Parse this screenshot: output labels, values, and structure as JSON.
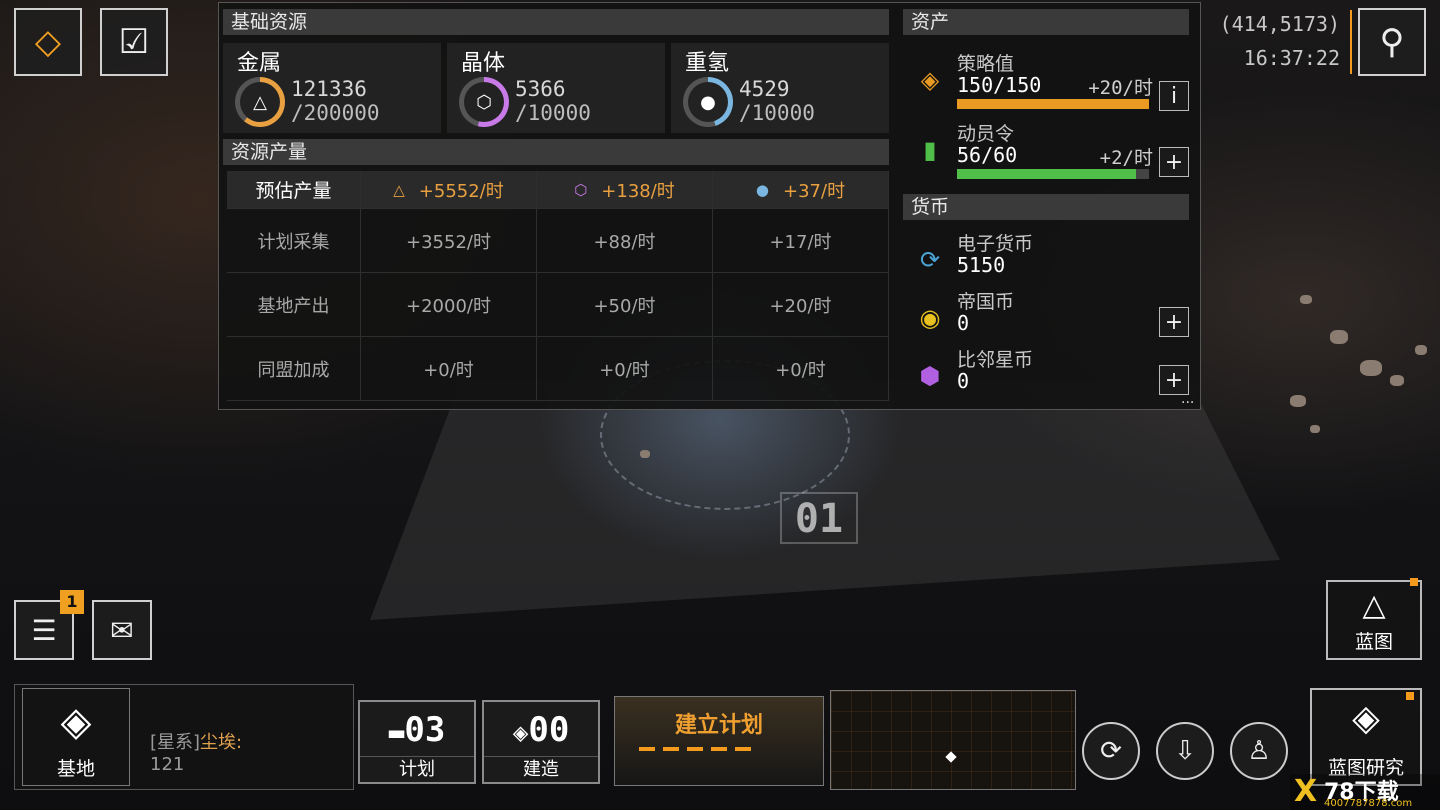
{
  "colors": {
    "accent": "#f49b1e",
    "metal": "#e8a040",
    "crystal": "#c87be8",
    "gas": "#7ab6e0",
    "strategy_bar": "#e89a22",
    "mobilize_bar": "#4fbf4a",
    "badge": "#f0a020"
  },
  "scene": {
    "plot_number": "01"
  },
  "top_left": {
    "buttons": [
      {
        "icon": "base-beacon-icon"
      },
      {
        "icon": "task-checklist-icon"
      }
    ]
  },
  "basic_resources": {
    "header": "基础资源",
    "items": [
      {
        "name": "金属",
        "current": "121336",
        "max": "/200000",
        "fill": 0.61,
        "icon": "metal-triangle-icon"
      },
      {
        "name": "晶体",
        "current": "5366",
        "max": "/10000",
        "fill": 0.54,
        "icon": "crystal-hexagon-icon"
      },
      {
        "name": "重氢",
        "current": "4529",
        "max": "/10000",
        "fill": 0.45,
        "icon": "deuterium-orb-icon"
      }
    ]
  },
  "production": {
    "header": "资源产量",
    "estimated_label": "预估产量",
    "estimated": [
      "+5552/时",
      "+138/时",
      "+37/时"
    ],
    "rows": [
      {
        "label": "计划采集",
        "values": [
          "+3552/时",
          "+88/时",
          "+17/时"
        ]
      },
      {
        "label": "基地产出",
        "values": [
          "+2000/时",
          "+50/时",
          "+20/时"
        ]
      },
      {
        "label": "同盟加成",
        "values": [
          "+0/时",
          "+0/时",
          "+0/时"
        ]
      }
    ]
  },
  "assets": {
    "header": "资产",
    "strategy": {
      "label": "策略值",
      "value": "150/150",
      "rate": "+20/时",
      "fill": 1.0,
      "button": "i"
    },
    "mobilize": {
      "label": "动员令",
      "value": "56/60",
      "rate": "+2/时",
      "fill": 0.93,
      "button": "+"
    }
  },
  "currency": {
    "header": "货币",
    "items": [
      {
        "label": "电子货币",
        "value": "5150",
        "icon": "e-currency-icon",
        "color": "#4ba3d6",
        "button": ""
      },
      {
        "label": "帝国币",
        "value": "0",
        "icon": "empire-coin-icon",
        "color": "#e8c020",
        "button": "+"
      },
      {
        "label": "比邻星币",
        "value": "0",
        "icon": "proxima-coin-icon",
        "color": "#b060e0",
        "button": "+"
      }
    ],
    "more": "..."
  },
  "status": {
    "coords": "(414,5173)",
    "clock": "16:37:22"
  },
  "left_side": {
    "notes_badge": "1"
  },
  "bottom": {
    "base_label": "基地",
    "system_label": "[星系]",
    "system_name": "尘埃:",
    "system_value": "121",
    "plans": {
      "count": "03",
      "label": "计划"
    },
    "builds": {
      "count": "00",
      "label": "建造"
    },
    "create_plan": "建立计划",
    "blueprint": "蓝图",
    "blueprint_research": "蓝图研究"
  },
  "watermark": {
    "text": "78下载",
    "url": "4007787878.com"
  }
}
